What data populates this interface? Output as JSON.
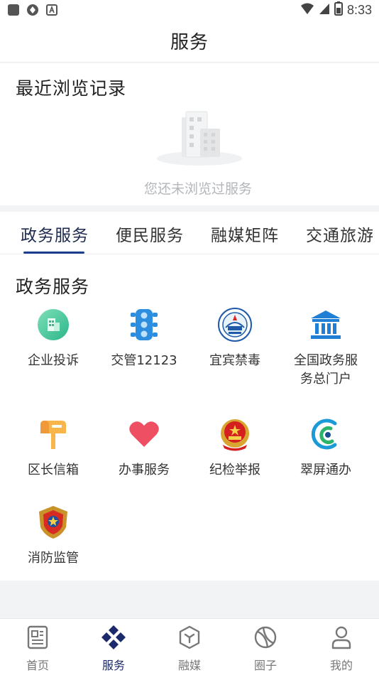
{
  "status_bar": {
    "time": "8:33",
    "left_icons": [
      "square-app-icon",
      "aperture-icon",
      "font-a-icon"
    ],
    "right_icons": [
      "wifi-icon",
      "signal-icon",
      "battery-icon"
    ]
  },
  "header": {
    "title": "服务"
  },
  "recent": {
    "title": "最近浏览记录",
    "empty_text": "您还未浏览过服务"
  },
  "tabs": [
    {
      "label": "政务服务",
      "active": true
    },
    {
      "label": "便民服务",
      "active": false
    },
    {
      "label": "融媒矩阵",
      "active": false
    },
    {
      "label": "交通旅游",
      "active": false
    }
  ],
  "gov_section": {
    "title": "政务服务",
    "items": [
      {
        "label": "企业投诉",
        "icon": "building-icon"
      },
      {
        "label": "交管12123",
        "icon": "traffic-light-icon"
      },
      {
        "label": "宜宾禁毒",
        "icon": "anti-drug-emblem-icon"
      },
      {
        "label": "全国政务服务总门户",
        "label_line1": "全国政务服",
        "label_line2": "务总门户",
        "icon": "government-building-icon"
      },
      {
        "label": "区长信箱",
        "icon": "mailbox-icon"
      },
      {
        "label": "办事服务",
        "icon": "heart-icon"
      },
      {
        "label": "纪检举报",
        "icon": "national-emblem-icon"
      },
      {
        "label": "翠屏通办",
        "icon": "cuiping-logo-icon"
      },
      {
        "label": "消防监管",
        "icon": "fire-emblem-icon"
      }
    ]
  },
  "bottom_nav": [
    {
      "label": "首页",
      "icon": "news-icon",
      "active": false
    },
    {
      "label": "服务",
      "icon": "diamond-grid-icon",
      "active": true
    },
    {
      "label": "融媒",
      "icon": "cube-icon",
      "active": false
    },
    {
      "label": "圈子",
      "icon": "orbit-icon",
      "active": false
    },
    {
      "label": "我的",
      "icon": "person-icon",
      "active": false
    }
  ],
  "colors": {
    "accent": "#1a3d8f",
    "text": "#222222",
    "muted": "#b3b6ba",
    "background": "#f2f3f5"
  }
}
